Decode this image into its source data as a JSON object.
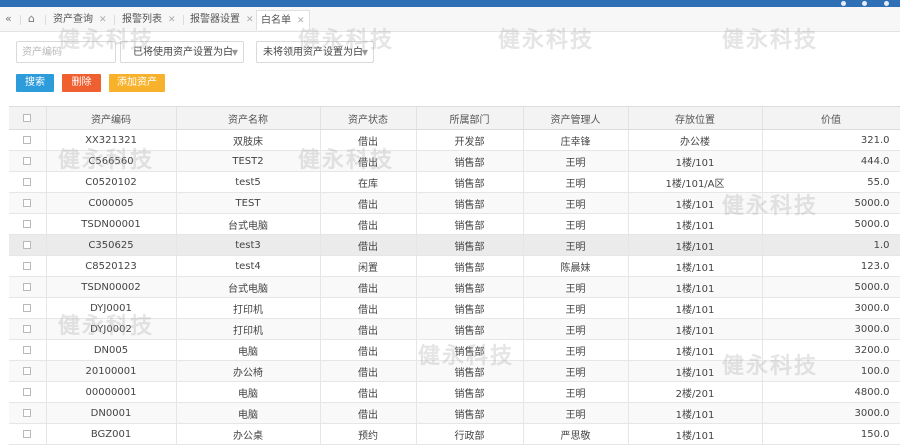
{
  "tabs": [
    {
      "label": "资产查询"
    },
    {
      "label": "报警列表"
    },
    {
      "label": "报警器设置"
    },
    {
      "label": "白名单"
    }
  ],
  "filters": {
    "asset_code_placeholder": "资产编码",
    "used_select": "已将使用资产设置为白",
    "unused_select": "未将领用资产设置为白"
  },
  "buttons": {
    "search": "搜索",
    "delete": "删除",
    "add": "添加资产"
  },
  "table": {
    "columns": [
      "资产编码",
      "资产名称",
      "资产状态",
      "所属部门",
      "资产管理人",
      "存放位置",
      "价值"
    ],
    "rows": [
      [
        "XX321321",
        "双肢床",
        "借出",
        "开发部",
        "庄幸锋",
        "办公楼",
        "321.0"
      ],
      [
        "C566560",
        "TEST2",
        "借出",
        "销售部",
        "王明",
        "1楼/101",
        "444.0"
      ],
      [
        "C0520102",
        "test5",
        "在库",
        "销售部",
        "王明",
        "1楼/101/A区",
        "55.0"
      ],
      [
        "C000005",
        "TEST",
        "借出",
        "销售部",
        "王明",
        "1楼/101",
        "5000.0"
      ],
      [
        "TSDN00001",
        "台式电脑",
        "借出",
        "销售部",
        "王明",
        "1楼/101",
        "5000.0"
      ],
      [
        "C350625",
        "test3",
        "借出",
        "销售部",
        "王明",
        "1楼/101",
        "1.0"
      ],
      [
        "C8520123",
        "test4",
        "闲置",
        "销售部",
        "陈晨妹",
        "1楼/101",
        "123.0"
      ],
      [
        "TSDN00002",
        "台式电脑",
        "借出",
        "销售部",
        "王明",
        "1楼/101",
        "5000.0"
      ],
      [
        "DYJ0001",
        "打印机",
        "借出",
        "销售部",
        "王明",
        "1楼/101",
        "3000.0"
      ],
      [
        "DYJ0002",
        "打印机",
        "借出",
        "销售部",
        "王明",
        "1楼/101",
        "3000.0"
      ],
      [
        "DN005",
        "电脑",
        "借出",
        "销售部",
        "王明",
        "1楼/101",
        "3200.0"
      ],
      [
        "20100001",
        "办公椅",
        "借出",
        "销售部",
        "王明",
        "1楼/101",
        "100.0"
      ],
      [
        "00000001",
        "电脑",
        "借出",
        "销售部",
        "王明",
        "2楼/201",
        "4800.0"
      ],
      [
        "DN0001",
        "电脑",
        "借出",
        "销售部",
        "王明",
        "1楼/101",
        "3000.0"
      ],
      [
        "BGZ001",
        "办公桌",
        "预约",
        "行政部",
        "严思敬",
        "1楼/101",
        "150.0"
      ]
    ]
  },
  "watermark": "健永科技"
}
